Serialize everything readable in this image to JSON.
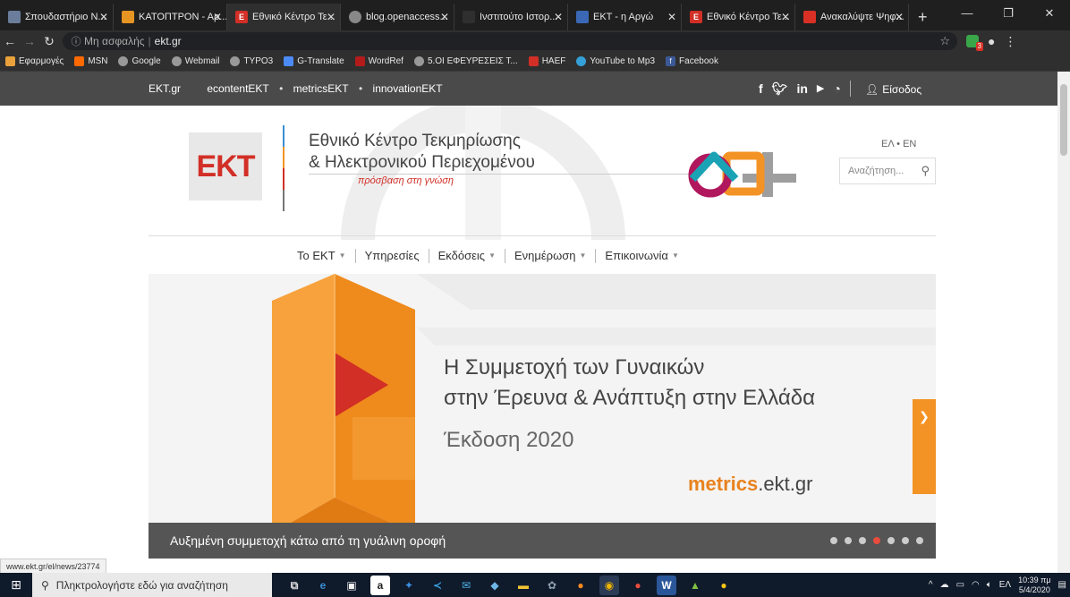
{
  "browser": {
    "tabs": [
      {
        "label": "Σπουδαστήριο Ν...",
        "favicon": "#6a7d9a",
        "active": false
      },
      {
        "label": "ΚΑΤΟΠΤΡΟΝ - Αρ...",
        "favicon": "#e69522",
        "active": false
      },
      {
        "label": "Εθνικό Κέντρο Τε...",
        "favicon": "#d22f27",
        "active": true
      },
      {
        "label": "blog.openaccess...",
        "favicon": "#888888",
        "active": false
      },
      {
        "label": "Ινστιτούτο Ιστορ...",
        "favicon": "#2f2f2f",
        "active": false
      },
      {
        "label": "ΕΚΤ - η Αργώ",
        "favicon": "#3a68b5",
        "active": false
      },
      {
        "label": "Εθνικό Κέντρο Τε...",
        "favicon": "#d22f27",
        "active": false
      },
      {
        "label": "Ανακαλύψτε Ψηφ...",
        "favicon": "#d93025",
        "active": false
      }
    ],
    "new_tab": "+",
    "address": {
      "security": "Μη ασφαλής",
      "url": "ekt.gr"
    },
    "bookmarks": [
      {
        "label": "Εφαρμογές",
        "icon": "apps-icon",
        "color": "#e9a23b"
      },
      {
        "label": "MSN",
        "icon": "msn-icon",
        "color": "#ff6a00"
      },
      {
        "label": "Google",
        "icon": "globe-icon",
        "color": "#999999"
      },
      {
        "label": "Webmail",
        "icon": "globe-icon",
        "color": "#999999"
      },
      {
        "label": "TYPO3",
        "icon": "globe-icon",
        "color": "#999999"
      },
      {
        "label": "G-Translate",
        "icon": "translate-icon",
        "color": "#4c8bf5"
      },
      {
        "label": "WordRef",
        "icon": "wordref-icon",
        "color": "#b31b1b"
      },
      {
        "label": "5.ΟΙ ΕΦΕΥΡΕΣΕΙΣ Τ...",
        "icon": "globe-icon",
        "color": "#999999"
      },
      {
        "label": "HAEF",
        "icon": "haef-icon",
        "color": "#d22f27"
      },
      {
        "label": "YouTube to Mp3",
        "icon": "youtube-icon",
        "color": "#35a0d8"
      },
      {
        "label": "Facebook",
        "icon": "facebook-icon",
        "color": "#3b5998"
      }
    ]
  },
  "site": {
    "topbar": {
      "home": "EKT.gr",
      "links": [
        "econtentEKT",
        "metricsEKT",
        "innovationEKT"
      ],
      "social": [
        "f",
        "t",
        "in",
        "yt",
        "rss"
      ],
      "login": "Είσοδος"
    },
    "header": {
      "logo": "EKT",
      "name_line1": "Εθνικό Κέντρο Τεκμηρίωσης",
      "name_line2": "& Ηλεκτρονικού Περιεχομένου",
      "tagline": "πρόσβαση στη γνώση",
      "lang_el": "ΕΛ",
      "lang_en": "EN",
      "search_placeholder": "Αναζήτηση..."
    },
    "nav": [
      {
        "label": "Το ΕΚΤ",
        "has_menu": true
      },
      {
        "label": "Υπηρεσίες",
        "has_menu": false
      },
      {
        "label": "Εκδόσεις",
        "has_menu": true
      },
      {
        "label": "Ενημέρωση",
        "has_menu": true
      },
      {
        "label": "Επικοινωνία",
        "has_menu": true
      }
    ],
    "slider": {
      "title_line1": "Η Συμμετοχή των Γυναικών",
      "title_line2": "στην Έρευνα & Ανάπτυξη στην Ελλάδα",
      "edition": "Έκδοση 2020",
      "brand_bold": "metrics",
      "brand_rest": ".ekt.gr",
      "caption": "Αυξημένη συμμετοχή κάτω από τη γυάλινη οροφή",
      "dots": 7,
      "active_dot": 3
    },
    "colors": {
      "brand_red": "#d22f27",
      "accent_orange": "#f39325"
    }
  },
  "status_url": "www.ekt.gr/el/news/23774",
  "taskbar": {
    "search_placeholder": "Πληκτρολογήστε εδώ για αναζήτηση",
    "lang": "ΕΛ",
    "time": "10:39 πμ",
    "date": "5/4/2020"
  }
}
